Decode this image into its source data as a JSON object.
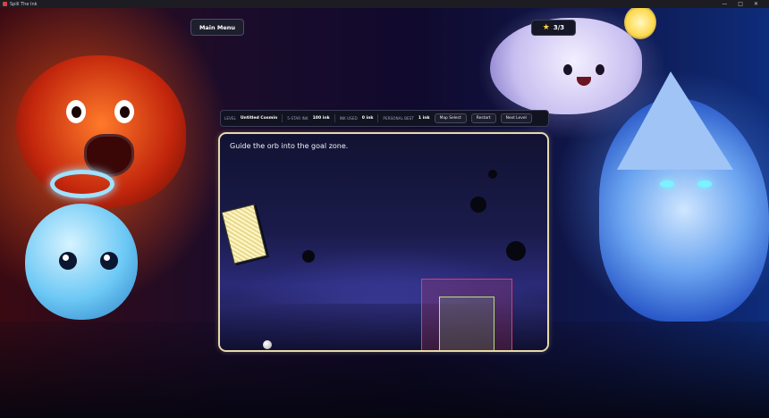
{
  "window": {
    "title": "Spill The Ink",
    "controls": [
      "—",
      "□",
      "✕"
    ]
  },
  "main_menu": {
    "label": "Main Menu"
  },
  "stars": {
    "icon": "star-icon",
    "text": "3/3"
  },
  "hud": {
    "level_label": "LEVEL",
    "level_value": "Untitled Cosmin",
    "five_star_label": "5-STAR INK",
    "five_star_value": "100 ink",
    "ink_used_label": "INK USED",
    "ink_used_value": "0 ink",
    "best_label": "PERSONAL BEST",
    "best_value": "1 ink",
    "map_select": "Map Select",
    "restart": "Restart",
    "next_level": "Next Level"
  },
  "game": {
    "instruction": "Guide the orb into the goal zone.",
    "goal_color": "#b5e27a",
    "outer_zone_color": "#d2406a"
  }
}
